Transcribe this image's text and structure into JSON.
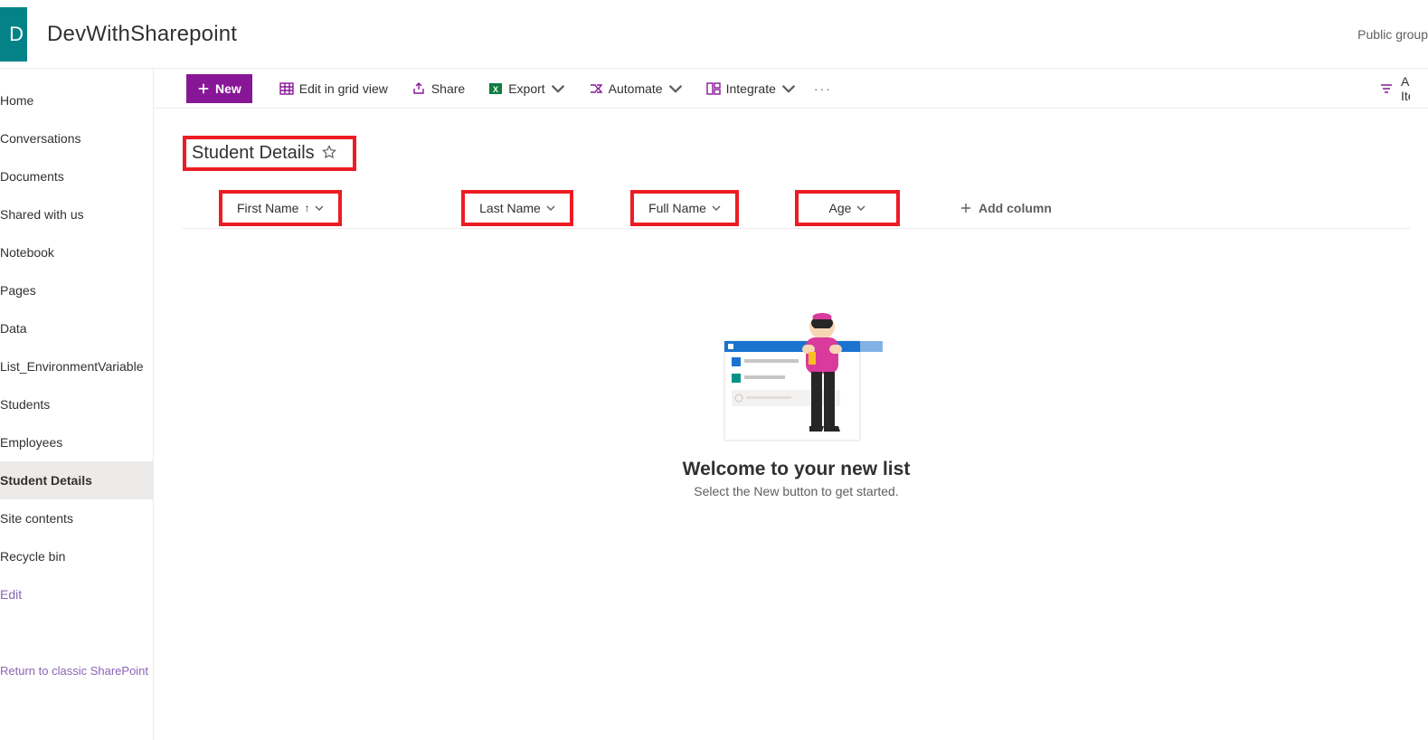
{
  "header": {
    "logo_letter": "D",
    "site_title": "DevWithSharepoint",
    "site_subtitle": "Public group"
  },
  "nav": {
    "items": [
      {
        "label": "Home"
      },
      {
        "label": "Conversations"
      },
      {
        "label": "Documents"
      },
      {
        "label": "Shared with us"
      },
      {
        "label": "Notebook"
      },
      {
        "label": "Pages"
      },
      {
        "label": "Data"
      },
      {
        "label": "List_EnvironmentVariable"
      },
      {
        "label": "Students"
      },
      {
        "label": "Employees"
      },
      {
        "label": "Student Details",
        "selected": true
      },
      {
        "label": "Site contents"
      },
      {
        "label": "Recycle bin"
      },
      {
        "label": "Edit",
        "edit": true
      }
    ],
    "footer": "Return to classic SharePoint"
  },
  "commands": {
    "new": "New",
    "edit_grid": "Edit in grid view",
    "share": "Share",
    "export": "Export",
    "automate": "Automate",
    "integrate": "Integrate",
    "all_items": "All Items"
  },
  "list": {
    "title": "Student Details",
    "columns": {
      "first": "First Name",
      "last": "Last Name",
      "full": "Full Name",
      "age": "Age",
      "add": "Add column"
    },
    "empty": {
      "title": "Welcome to your new list",
      "subtitle": "Select the New button to get started."
    }
  }
}
